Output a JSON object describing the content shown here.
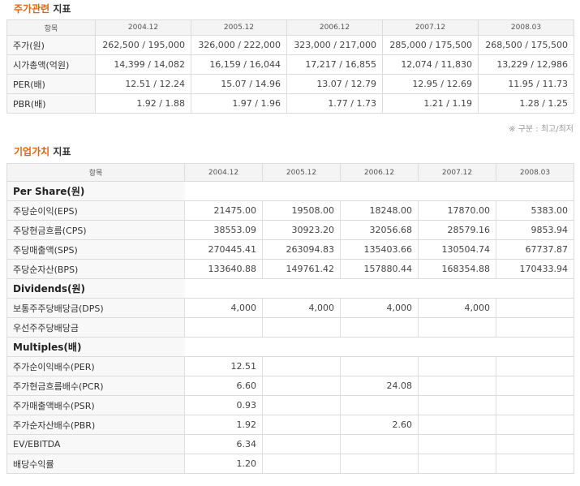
{
  "stock": {
    "title_accent": "주가관련",
    "title_rest": "지표",
    "header": [
      "항목",
      "2004.12",
      "2005.12",
      "2006.12",
      "2007.12",
      "2008.03"
    ],
    "rows": [
      {
        "label": "주가(원)",
        "values": [
          "262,500 / 195,000",
          "326,000 / 222,000",
          "323,000 / 217,000",
          "285,000 / 175,500",
          "268,500 / 175,500"
        ]
      },
      {
        "label": "시가총액(억원)",
        "values": [
          "14,399 / 14,082",
          "16,159 / 16,044",
          "17,217 / 16,855",
          "12,074 / 11,830",
          "13,229 / 12,986"
        ]
      },
      {
        "label": "PER(배)",
        "values": [
          "12.51 / 12.24",
          "15.07 / 14.96",
          "13.07 / 12.79",
          "12.95 / 12.69",
          "11.95 / 11.73"
        ]
      },
      {
        "label": "PBR(배)",
        "values": [
          "1.92 / 1.88",
          "1.97 / 1.96",
          "1.77 / 1.73",
          "1.21 / 1.19",
          "1.28 / 1.25"
        ]
      }
    ],
    "note": "※ 구분 : 최고/최저"
  },
  "value": {
    "title_accent": "기업가치",
    "title_rest": "지표",
    "header": [
      "항목",
      "2004.12",
      "2005.12",
      "2006.12",
      "2007.12",
      "2008.03"
    ],
    "rows": [
      {
        "group": "Per Share(원)"
      },
      {
        "label": "주당순이익(EPS)",
        "values": [
          "21475.00",
          "19508.00",
          "18248.00",
          "17870.00",
          "5383.00"
        ]
      },
      {
        "label": "주당현금흐름(CPS)",
        "values": [
          "38553.09",
          "30923.20",
          "32056.68",
          "28579.16",
          "9853.94"
        ]
      },
      {
        "label": "주당매출액(SPS)",
        "values": [
          "270445.41",
          "263094.83",
          "135403.66",
          "130504.74",
          "67737.87"
        ]
      },
      {
        "label": "주당순자산(BPS)",
        "values": [
          "133640.88",
          "149761.42",
          "157880.44",
          "168354.88",
          "170433.94"
        ]
      },
      {
        "group": "Dividends(원)"
      },
      {
        "label": "보통주주당배당금(DPS)",
        "values": [
          "4,000",
          "4,000",
          "4,000",
          "4,000",
          ""
        ]
      },
      {
        "label": "우선주주당배당금",
        "values": [
          "",
          "",
          "",
          "",
          ""
        ]
      },
      {
        "group": "Multiples(배)"
      },
      {
        "label": "주가순이익배수(PER)",
        "values": [
          "12.51",
          "",
          "",
          "",
          ""
        ]
      },
      {
        "label": "주가현금흐름배수(PCR)",
        "values": [
          "6.60",
          "",
          "24.08",
          "",
          ""
        ]
      },
      {
        "label": "주가매출액배수(PSR)",
        "values": [
          "0.93",
          "",
          "",
          "",
          ""
        ]
      },
      {
        "label": "주가순자산배수(PBR)",
        "values": [
          "1.92",
          "",
          "2.60",
          "",
          ""
        ]
      },
      {
        "label": "EV/EBITDA",
        "values": [
          "6.34",
          "",
          "",
          "",
          ""
        ]
      },
      {
        "label": "배당수익률",
        "values": [
          "1.20",
          "",
          "",
          "",
          ""
        ]
      }
    ]
  }
}
